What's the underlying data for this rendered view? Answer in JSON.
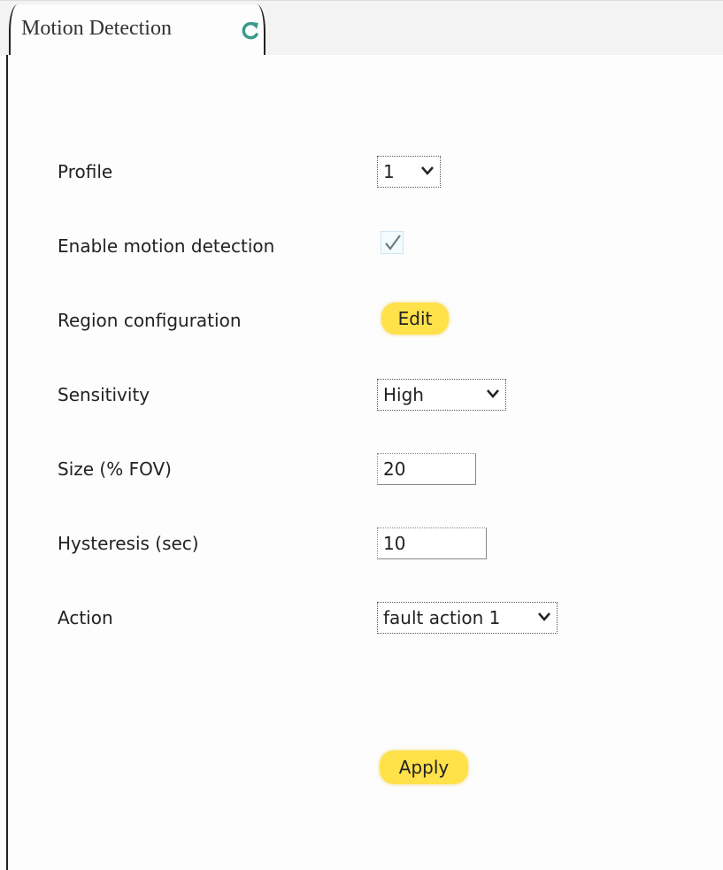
{
  "tab": {
    "title": "Motion Detection",
    "refresh_icon": "refresh-icon"
  },
  "form": {
    "profile": {
      "label": "Profile",
      "value": "1"
    },
    "enable": {
      "label": "Enable motion detection",
      "checked": true
    },
    "region": {
      "label": "Region configuration",
      "button_label": "Edit"
    },
    "sensitivity": {
      "label": "Sensitivity",
      "value": "High"
    },
    "size": {
      "label": "Size (% FOV)",
      "value": "20"
    },
    "hysteresis": {
      "label": "Hysteresis (sec)",
      "value": "10"
    },
    "action": {
      "label": "Action",
      "value": "fault action 1"
    }
  },
  "apply_label": "Apply",
  "colors": {
    "accent_button": "#ffe14a",
    "refresh_icon": "#3a9a8a"
  }
}
